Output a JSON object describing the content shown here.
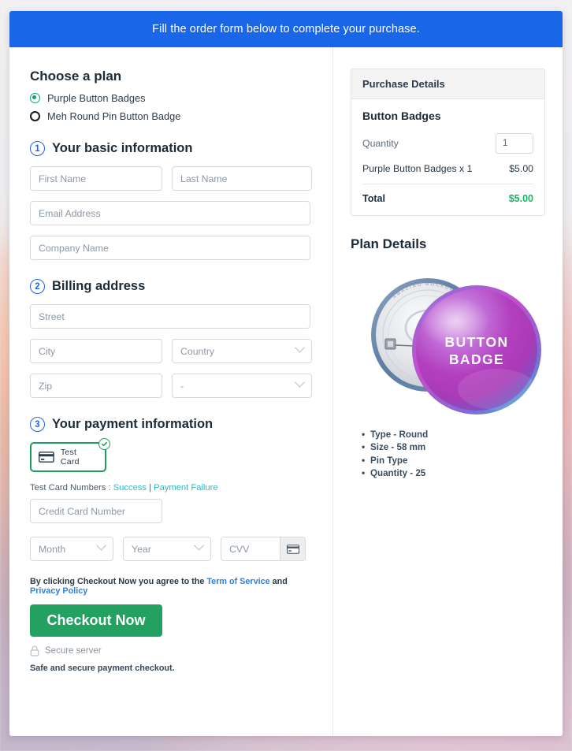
{
  "banner": {
    "text": "Fill the order form below to complete your purchase."
  },
  "plan": {
    "heading": "Choose a plan",
    "options": [
      {
        "label": "Purple Button Badges",
        "selected": true
      },
      {
        "label": "Meh Round Pin Button Badge",
        "selected": false
      }
    ]
  },
  "steps": {
    "basic": {
      "number": "1",
      "title": "Your basic information"
    },
    "billing": {
      "number": "2",
      "title": "Billing address"
    },
    "payment": {
      "number": "3",
      "title": "Your payment information"
    }
  },
  "fields": {
    "first_name": "First Name",
    "last_name": "Last Name",
    "email": "Email Address",
    "company": "Company Name",
    "street": "Street",
    "city": "City",
    "country": "Country",
    "zip": "Zip",
    "state": "-",
    "credit_card": "Credit Card Number",
    "month": "Month",
    "year": "Year",
    "cvv": "CVV"
  },
  "payment": {
    "card_option_label": "Test Card",
    "test_numbers_prefix": "Test Card Numbers :",
    "test_success": "Success",
    "test_separator": "|",
    "test_failure": "Payment Failure"
  },
  "terms": {
    "prefix": "By clicking Checkout Now you agree to the",
    "tos": "Term of Service",
    "conjunction": "and",
    "privacy": "Privacy Policy"
  },
  "checkout": {
    "button": "Checkout Now",
    "secure_server": "Secure server",
    "safe_note": "Safe and secure payment checkout."
  },
  "purchase": {
    "title": "Purchase Details",
    "product": "Button Badges",
    "quantity_label": "Quantity",
    "quantity_value": "1",
    "line_item_label": "Purple Button Badges x 1",
    "line_item_price": "$5.00",
    "total_label": "Total",
    "total_price": "$5.00"
  },
  "plan_details": {
    "title": "Plan Details",
    "badge_text_line1": "BUTTON",
    "badge_text_line2": "BADGE",
    "back_ring_text": "AMAZING MOCKUP COLLECTION",
    "bullets": [
      "Type - Round",
      "Size - 58 mm",
      "Pin Type",
      "Quantity - 25"
    ]
  },
  "colors": {
    "banner_blue": "#1a66e8",
    "step_blue": "#1a66e8",
    "checkout_green": "#23a160",
    "total_green": "#16b35f",
    "link_teal": "#29bcc4",
    "link_blue": "#2f7fe0",
    "selected_radio_green": "#0fa36b",
    "card_border_green": "#17a05e"
  },
  "icons": {
    "credit_card": "credit-card-icon",
    "check": "check-circle-icon",
    "lock": "lock-icon",
    "chevron": "chevron-down-icon"
  }
}
